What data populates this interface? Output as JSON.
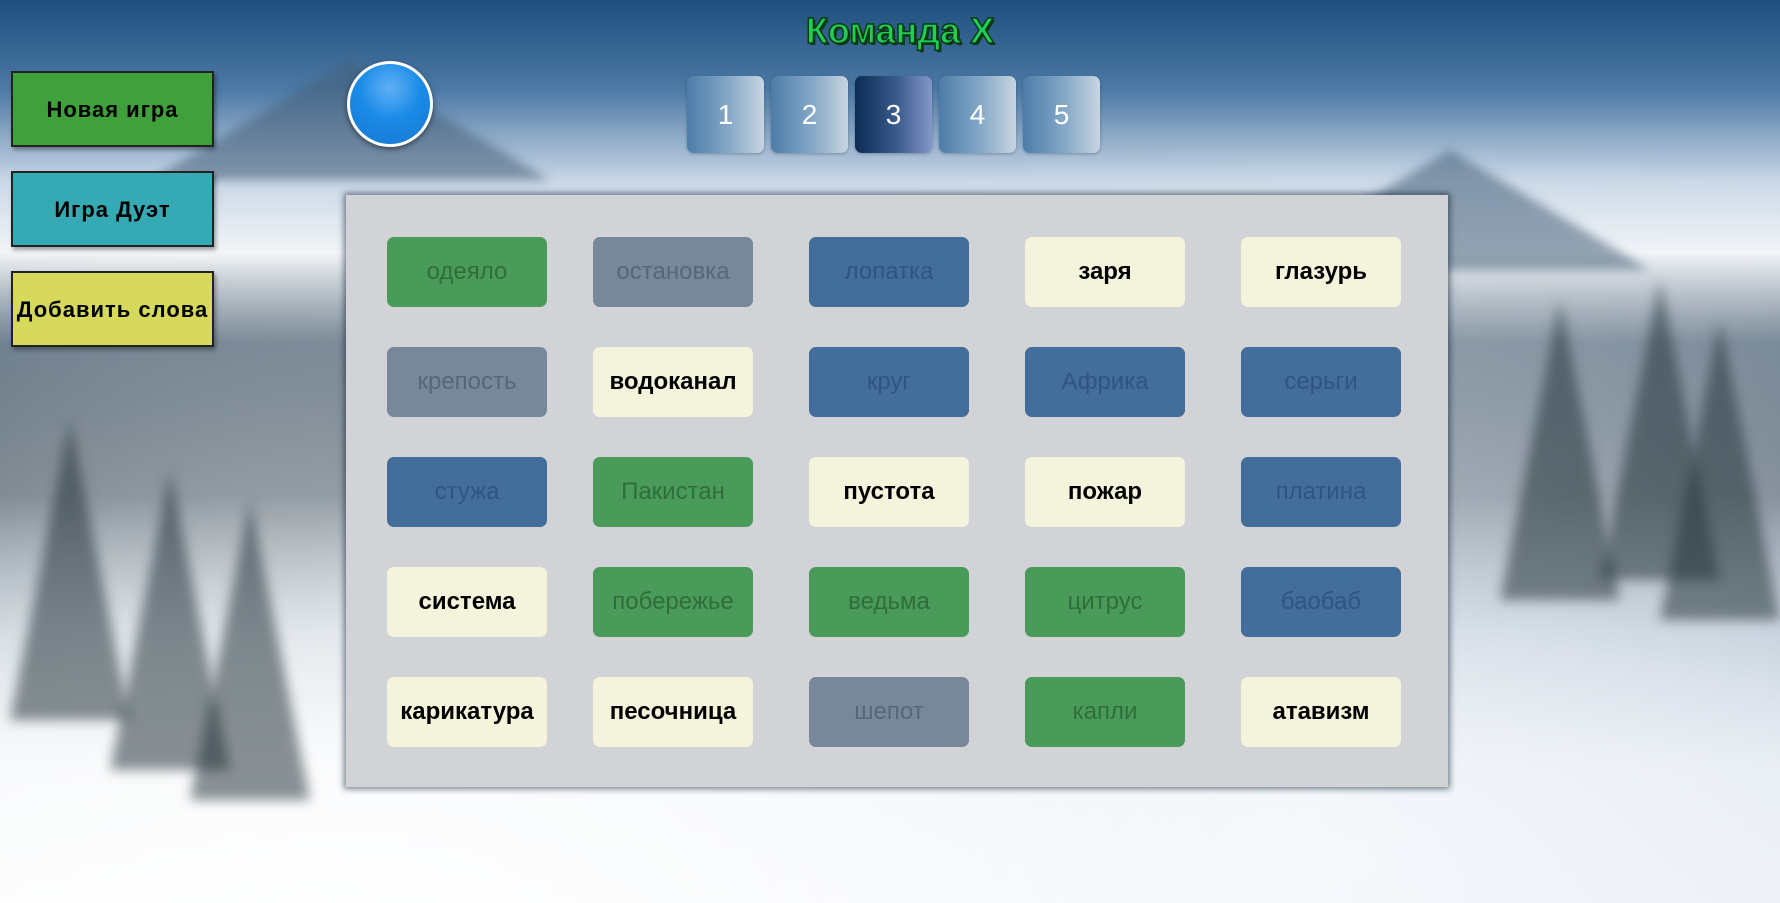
{
  "title": "Команда X",
  "sidebar": {
    "new_game": "Новая игра",
    "duet_game": "Игра Дуэт",
    "add_words": "Добавить слова"
  },
  "turn_indicator": {
    "color": "#1a8be8"
  },
  "tabs": [
    {
      "label": "1",
      "active": false
    },
    {
      "label": "2",
      "active": false
    },
    {
      "label": "3",
      "active": true
    },
    {
      "label": "4",
      "active": false
    },
    {
      "label": "5",
      "active": false
    }
  ],
  "colors": {
    "green": "#4a9b5a",
    "gray": "#77889a",
    "blue": "#436d9a",
    "white": "#f4f4dc",
    "title": "#22cc55"
  },
  "cards": [
    {
      "word": "одеяло",
      "state": "green"
    },
    {
      "word": "остановка",
      "state": "gray"
    },
    {
      "word": "лопатка",
      "state": "blue"
    },
    {
      "word": "заря",
      "state": "white"
    },
    {
      "word": "глазурь",
      "state": "white"
    },
    {
      "word": "крепость",
      "state": "gray"
    },
    {
      "word": "водоканал",
      "state": "white"
    },
    {
      "word": "круг",
      "state": "blue"
    },
    {
      "word": "Африка",
      "state": "blue"
    },
    {
      "word": "серьги",
      "state": "blue"
    },
    {
      "word": "стужа",
      "state": "blue"
    },
    {
      "word": "Пакистан",
      "state": "green"
    },
    {
      "word": "пустота",
      "state": "white"
    },
    {
      "word": "пожар",
      "state": "white"
    },
    {
      "word": "платина",
      "state": "blue"
    },
    {
      "word": "система",
      "state": "white"
    },
    {
      "word": "побережье",
      "state": "green"
    },
    {
      "word": "ведьма",
      "state": "green"
    },
    {
      "word": "цитрус",
      "state": "green"
    },
    {
      "word": "баобаб",
      "state": "blue"
    },
    {
      "word": "карикатура",
      "state": "white"
    },
    {
      "word": "песочница",
      "state": "white"
    },
    {
      "word": "шепот",
      "state": "gray"
    },
    {
      "word": "капли",
      "state": "green"
    },
    {
      "word": "атавизм",
      "state": "white"
    }
  ]
}
